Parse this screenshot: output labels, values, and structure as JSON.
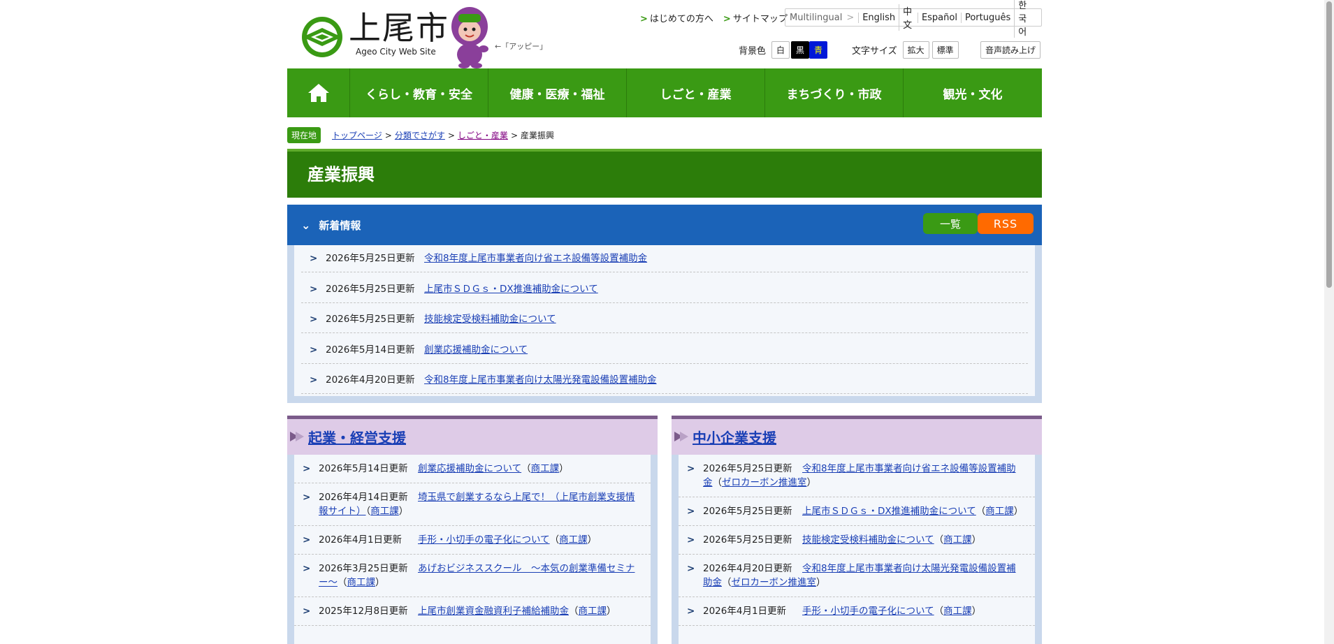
{
  "header": {
    "logo_title": "上尾市",
    "logo_sub": "Ageo City Web Site",
    "mascot_label": "←「アッピー」",
    "links": [
      "はじめての方へ",
      "サイトマップ"
    ],
    "lang_label": "Multilingual",
    "languages": [
      "English",
      "中文",
      "Español",
      "Português",
      "한국어"
    ],
    "bg_label": "背景色",
    "bg_options": [
      "白",
      "黒",
      "青"
    ],
    "font_label": "文字サイズ",
    "font_options": [
      "拡大",
      "標準"
    ],
    "speech": "音声読み上げ"
  },
  "nav": [
    "くらし・教育・安全",
    "健康・医療・福祉",
    "しごと・産業",
    "まちづくり・市政",
    "観光・文化"
  ],
  "breadcrumb": {
    "here": "現在地",
    "items": [
      "トップページ",
      "分類でさがす",
      "しごと・産業"
    ],
    "current": "産業振興"
  },
  "page_title": "産業振興",
  "news": {
    "title": "新着情報",
    "list_btn": "一覧",
    "rss_btn": "RSS",
    "items": [
      {
        "date": "2026年5月25日更新",
        "title": "令和8年度上尾市事業者向け省エネ設備等設置補助金"
      },
      {
        "date": "2026年5月25日更新",
        "title": "上尾市ＳＤＧｓ・DX推進補助金について"
      },
      {
        "date": "2026年5月25日更新",
        "title": "技能検定受検料補助金について"
      },
      {
        "date": "2026年5月14日更新",
        "title": "創業応援補助金について"
      },
      {
        "date": "2026年4月20日更新",
        "title": "令和8年度上尾市事業者向け太陽光発電設備設置補助金"
      }
    ]
  },
  "col1": {
    "title": "起業・経営支援",
    "items": [
      {
        "date": "2026年5月14日更新",
        "title": "創業応援補助金について",
        "dept": "商工課"
      },
      {
        "date": "2026年4月14日更新",
        "title": "埼玉県で創業するなら上尾で！（上尾市創業支援情報サイト）",
        "dept": "商工課"
      },
      {
        "date": "2026年4月1日更新",
        "title": "手形・小切手の電子化について",
        "dept": "商工課"
      },
      {
        "date": "2026年3月25日更新",
        "title": "あげおビジネススクール　～本気の創業準備セミナー～",
        "dept": "商工課"
      },
      {
        "date": "2025年12月8日更新",
        "title": "上尾市創業資金融資利子補給補助金",
        "dept": "商工課"
      }
    ]
  },
  "col2": {
    "title": "中小企業支援",
    "items": [
      {
        "date": "2026年5月25日更新",
        "title": "令和8年度上尾市事業者向け省エネ設備等設置補助金",
        "dept": "ゼロカーボン推進室"
      },
      {
        "date": "2026年5月25日更新",
        "title": "上尾市ＳＤＧｓ・DX推進補助金について",
        "dept": "商工課"
      },
      {
        "date": "2026年5月25日更新",
        "title": "技能検定受検料補助金について",
        "dept": "商工課"
      },
      {
        "date": "2026年4月20日更新",
        "title": "令和8年度上尾市事業者向け太陽光発電設備設置補助金",
        "dept": "ゼロカーボン推進室"
      },
      {
        "date": "2026年4月1日更新",
        "title": "手形・小切手の電子化について",
        "dept": "商工課"
      }
    ]
  },
  "colors": {
    "green": "#3a9a14",
    "blue": "#1b63b8",
    "orange": "#ff6a00",
    "purple": "#decbe7"
  }
}
